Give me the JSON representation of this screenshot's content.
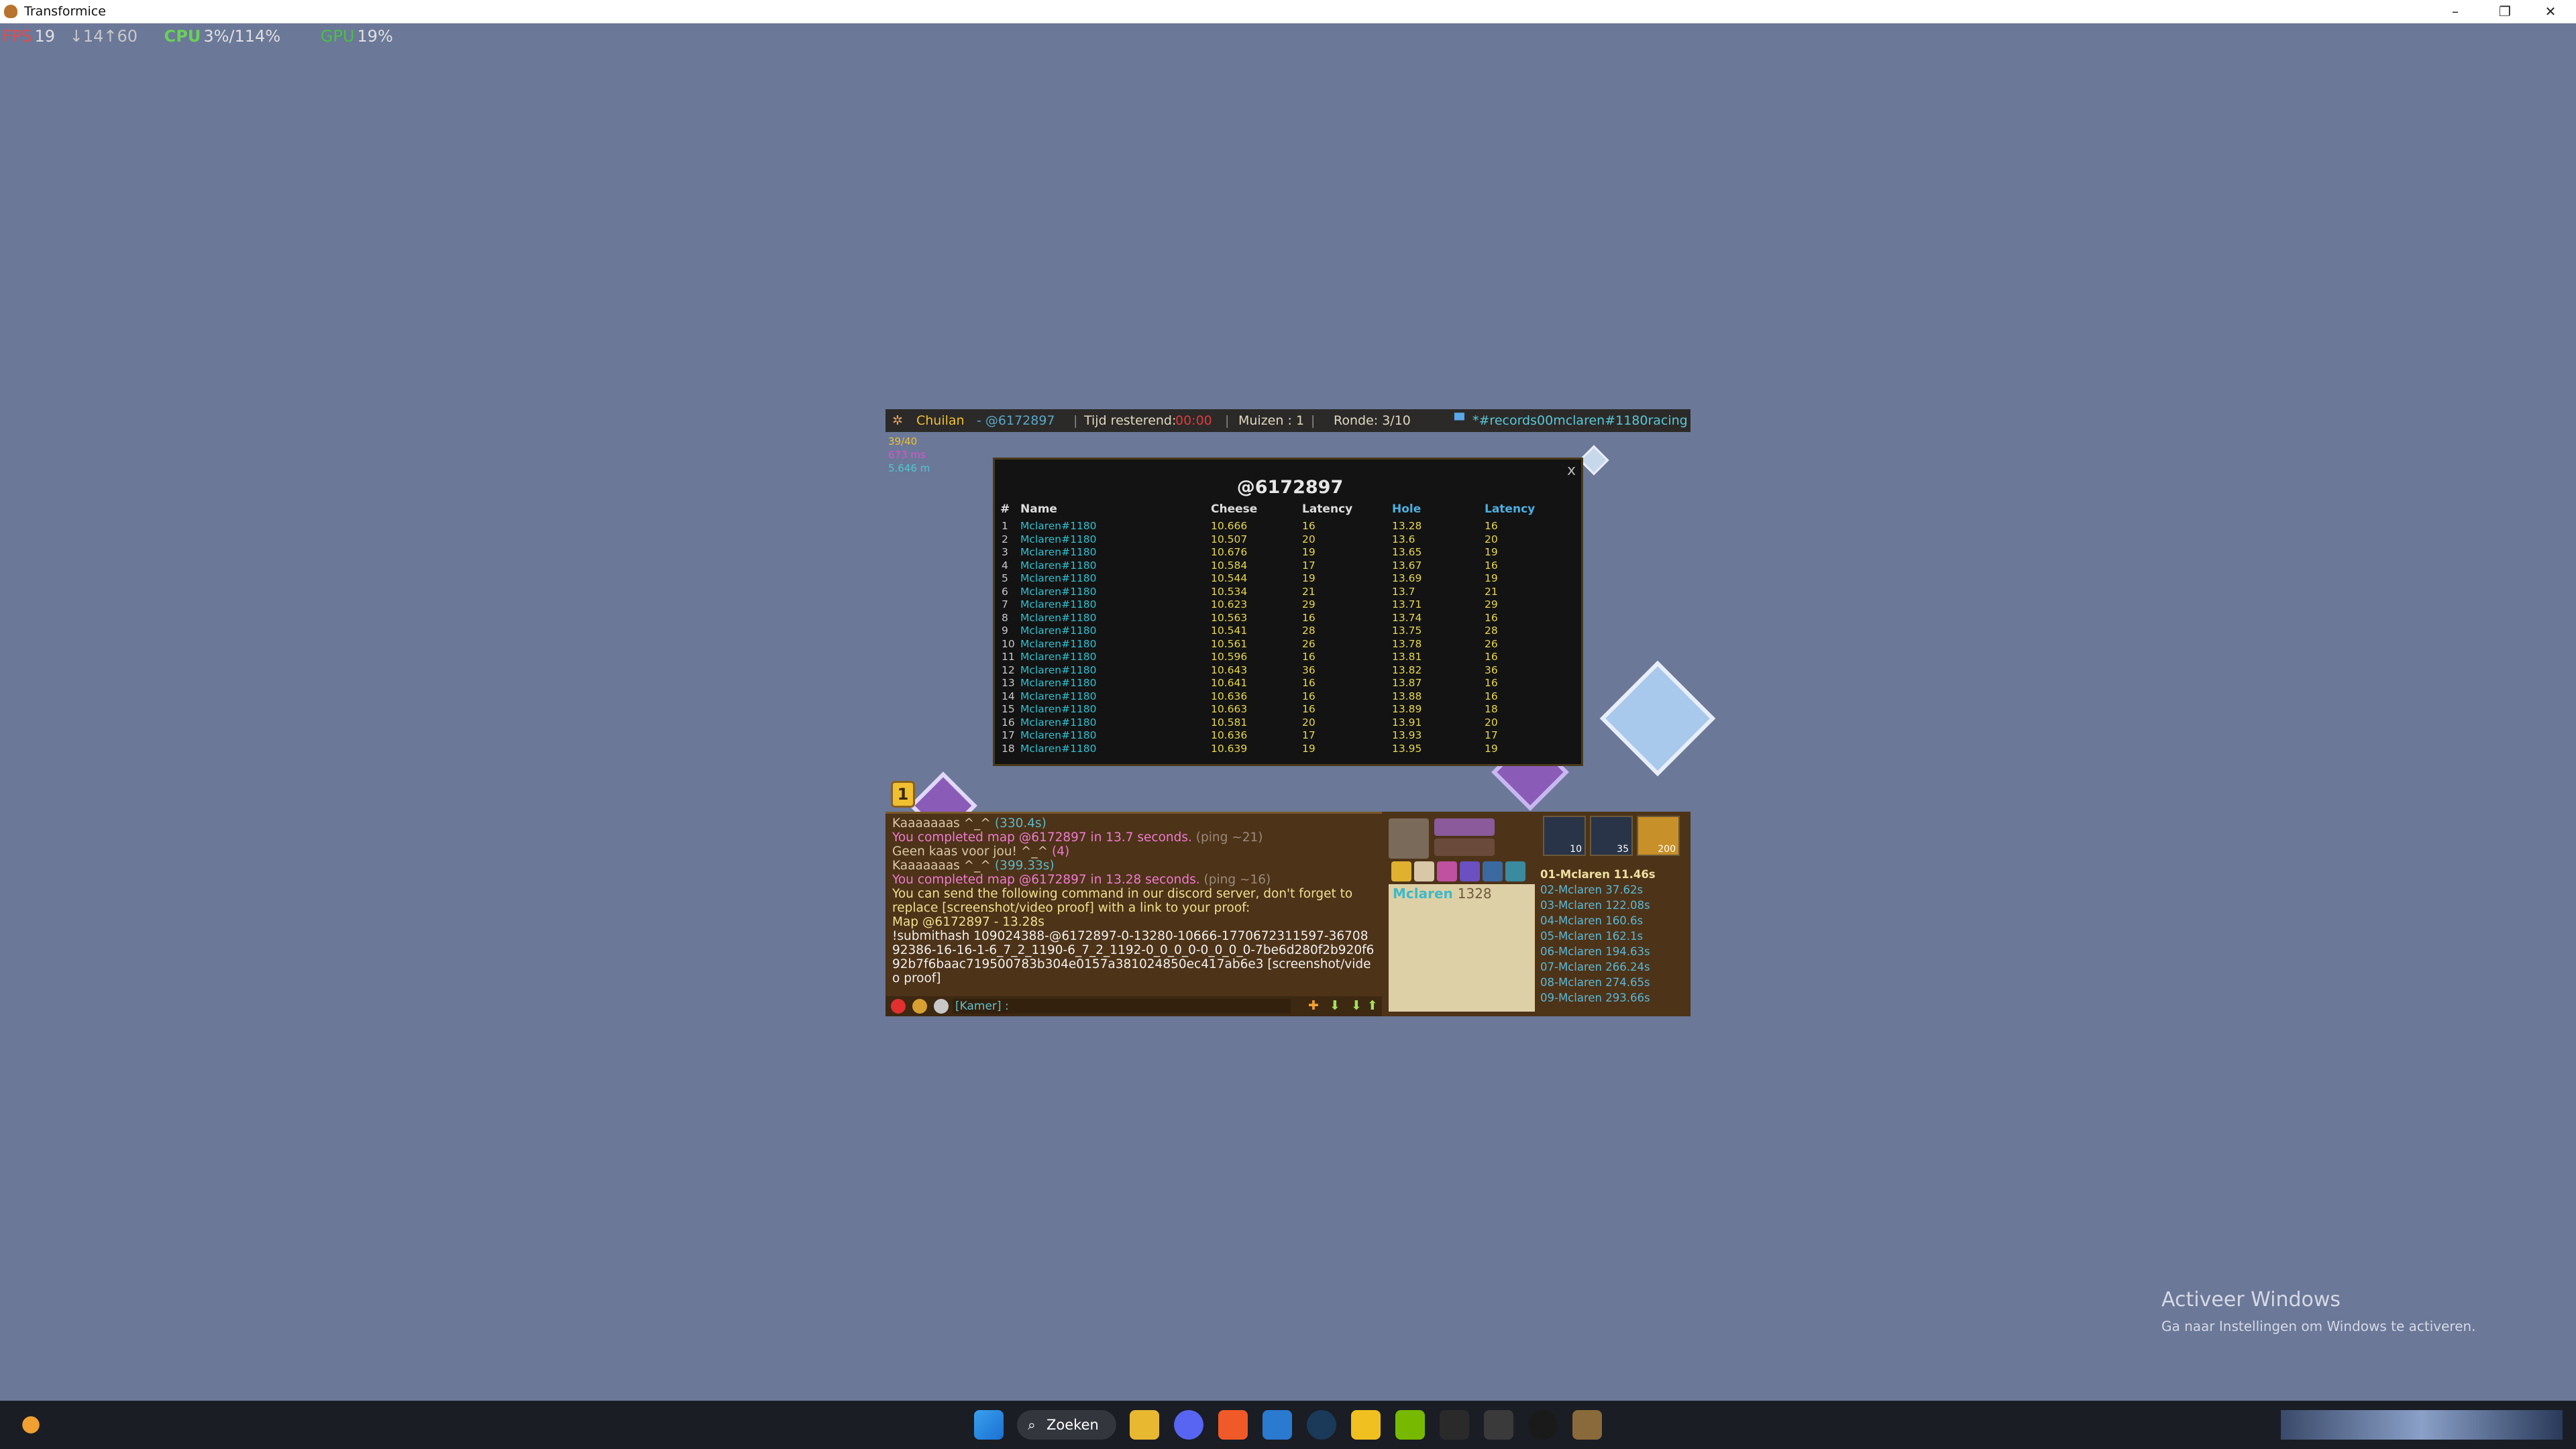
{
  "window": {
    "title": "Transformice",
    "minimize": "–",
    "restore": "❐",
    "close": "✕"
  },
  "overlay": {
    "fps_label": "FPS",
    "fps_value": "19",
    "fps_extra": "↓14↑60",
    "cpu_label": "CPU",
    "cpu_value": "3%/114%",
    "gpu_label": "GPU",
    "gpu_value": "19%"
  },
  "hud": {
    "player": "Chuilan",
    "map_code": "- @6172897",
    "time_label": "Tijd resterend:",
    "time_value": "00:00",
    "mice_label": "Muizen :",
    "mice_value": "1",
    "round_label": "Ronde: 3/10",
    "room": "*#records00mclaren#1180racing"
  },
  "stats": {
    "line1": "39/40",
    "line2": "673 ms",
    "line3": "5.646 m"
  },
  "scoreboard": {
    "title": "@6172897",
    "close": "x",
    "headers": {
      "num": "#",
      "name": "Name",
      "cheese": "Cheese",
      "latency": "Latency",
      "hole": "Hole",
      "latency2": "Latency"
    },
    "rows": [
      {
        "n": "1",
        "name": "Mclaren#1180",
        "cheese": "10.666",
        "lat": "16",
        "hole": "13.28",
        "lat2": "16"
      },
      {
        "n": "2",
        "name": "Mclaren#1180",
        "cheese": "10.507",
        "lat": "20",
        "hole": "13.6",
        "lat2": "20"
      },
      {
        "n": "3",
        "name": "Mclaren#1180",
        "cheese": "10.676",
        "lat": "19",
        "hole": "13.65",
        "lat2": "19"
      },
      {
        "n": "4",
        "name": "Mclaren#1180",
        "cheese": "10.584",
        "lat": "17",
        "hole": "13.67",
        "lat2": "16"
      },
      {
        "n": "5",
        "name": "Mclaren#1180",
        "cheese": "10.544",
        "lat": "19",
        "hole": "13.69",
        "lat2": "19"
      },
      {
        "n": "6",
        "name": "Mclaren#1180",
        "cheese": "10.534",
        "lat": "21",
        "hole": "13.7",
        "lat2": "21"
      },
      {
        "n": "7",
        "name": "Mclaren#1180",
        "cheese": "10.623",
        "lat": "29",
        "hole": "13.71",
        "lat2": "29"
      },
      {
        "n": "8",
        "name": "Mclaren#1180",
        "cheese": "10.563",
        "lat": "16",
        "hole": "13.74",
        "lat2": "16"
      },
      {
        "n": "9",
        "name": "Mclaren#1180",
        "cheese": "10.541",
        "lat": "28",
        "hole": "13.75",
        "lat2": "28"
      },
      {
        "n": "10",
        "name": "Mclaren#1180",
        "cheese": "10.561",
        "lat": "26",
        "hole": "13.78",
        "lat2": "26"
      },
      {
        "n": "11",
        "name": "Mclaren#1180",
        "cheese": "10.596",
        "lat": "16",
        "hole": "13.81",
        "lat2": "16"
      },
      {
        "n": "12",
        "name": "Mclaren#1180",
        "cheese": "10.643",
        "lat": "36",
        "hole": "13.82",
        "lat2": "36"
      },
      {
        "n": "13",
        "name": "Mclaren#1180",
        "cheese": "10.641",
        "lat": "16",
        "hole": "13.87",
        "lat2": "16"
      },
      {
        "n": "14",
        "name": "Mclaren#1180",
        "cheese": "10.636",
        "lat": "16",
        "hole": "13.88",
        "lat2": "16"
      },
      {
        "n": "15",
        "name": "Mclaren#1180",
        "cheese": "10.663",
        "lat": "16",
        "hole": "13.89",
        "lat2": "18"
      },
      {
        "n": "16",
        "name": "Mclaren#1180",
        "cheese": "10.581",
        "lat": "20",
        "hole": "13.91",
        "lat2": "20"
      },
      {
        "n": "17",
        "name": "Mclaren#1180",
        "cheese": "10.636",
        "lat": "17",
        "hole": "13.93",
        "lat2": "17"
      },
      {
        "n": "18",
        "name": "Mclaren#1180",
        "cheese": "10.639",
        "lat": "19",
        "hole": "13.95",
        "lat2": "19"
      }
    ]
  },
  "level_badge": "1",
  "chat": {
    "line1": "Kaaaaaaas ^_^",
    "line1_time": "(330.4s)",
    "line2": "You completed map @6172897 in 13.7 seconds.",
    "line2_ping": "(ping ~21)",
    "line3": "Geen kaas voor jou! ^_^",
    "line3_count": "(4)",
    "line4": "Kaaaaaaas ^_^",
    "line4_time": "(399.33s)",
    "line5": "You completed map @6172897 in 13.28 seconds.",
    "line5_ping": "(ping ~16)",
    "line6": "You can send the following command in our discord server, don't forget to replace [screenshot/video proof] with a link to your proof:",
    "line7": "Map @6172897 - 13.28s",
    "line8": "!submithash 109024388-@6172897-0-13280-10666-1770672311597-3670892386-16-16-1-6_7_2_1190-6_7_2_1192-0_0_0_0-0_0_0_0-7be6d280f2b920f692b7f6baac719500783b304e0157a381024850ec417ab6e3 [screenshot/video proof]",
    "input_placeholder": "[Kamer] :"
  },
  "profile": {
    "name": "Mclaren",
    "score": "1328"
  },
  "badges": [
    "10",
    "35",
    "200"
  ],
  "ranking": [
    "01-Mclaren 11.46s",
    "02-Mclaren 37.62s",
    "03-Mclaren 122.08s",
    "04-Mclaren 160.6s",
    "05-Mclaren 162.1s",
    "06-Mclaren 194.63s",
    "07-Mclaren 266.24s",
    "08-Mclaren 274.65s",
    "09-Mclaren 293.66s"
  ],
  "colors": {
    "accent_blue": "#4cb0e0",
    "name_cyan": "#2fc1d0",
    "value_yellow": "#e8d84a",
    "chat_pink": "#f07ad0",
    "panel_brown": "#4d3318"
  },
  "taskbar": {
    "search_label": "Zoeken"
  },
  "watermark": {
    "line1": "Activeer Windows",
    "line2": "Ga naar Instellingen om Windows te activeren."
  }
}
